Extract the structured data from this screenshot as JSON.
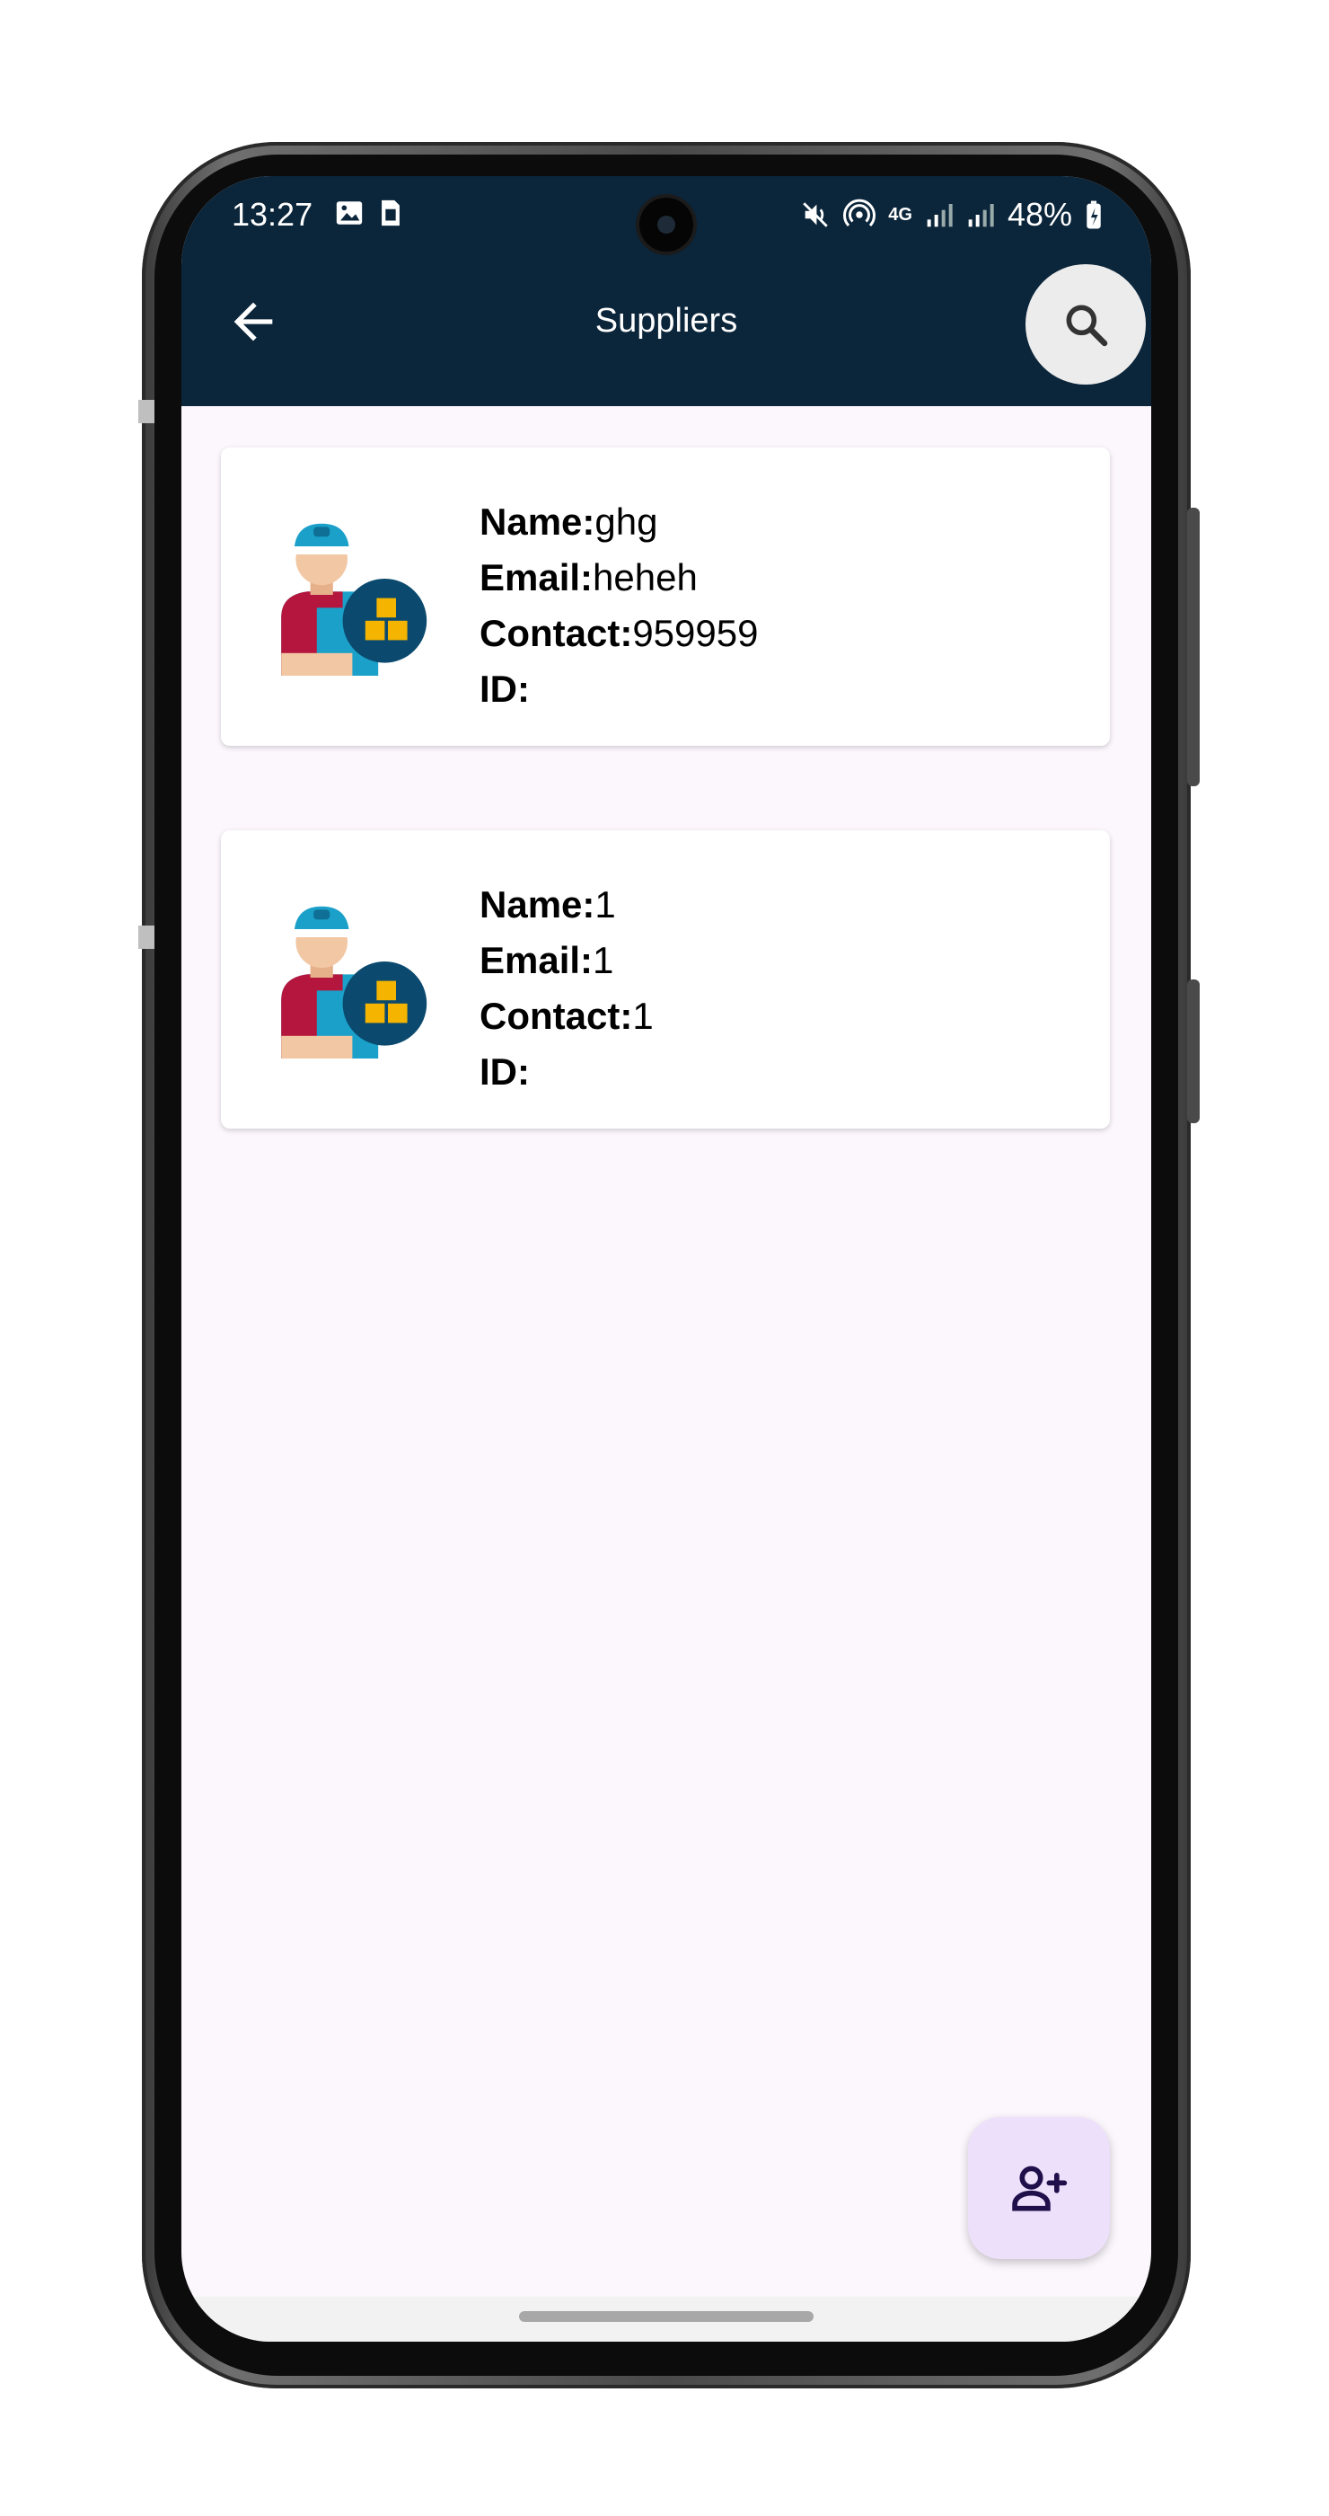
{
  "status_bar": {
    "time": "13:27",
    "battery": "48%",
    "network": "4G"
  },
  "app_bar": {
    "title": "Suppliers"
  },
  "labels": {
    "name": "Name:",
    "email": "Email:",
    "contact": "Contact:",
    "id": "ID:"
  },
  "suppliers": [
    {
      "name": "ghg",
      "email": "heheh",
      "contact": "959959",
      "id": ""
    },
    {
      "name": "1",
      "email": "1",
      "contact": "1",
      "id": ""
    }
  ],
  "icons": {
    "back": "arrow-left-icon",
    "search": "search-icon",
    "avatar": "supplier-worker-icon",
    "fab": "person-add-icon"
  },
  "colors": {
    "app_bar": "#0b253a",
    "background": "#fcf6fd",
    "fab": "#ece0fb",
    "fab_icon": "#1f0f4a"
  }
}
